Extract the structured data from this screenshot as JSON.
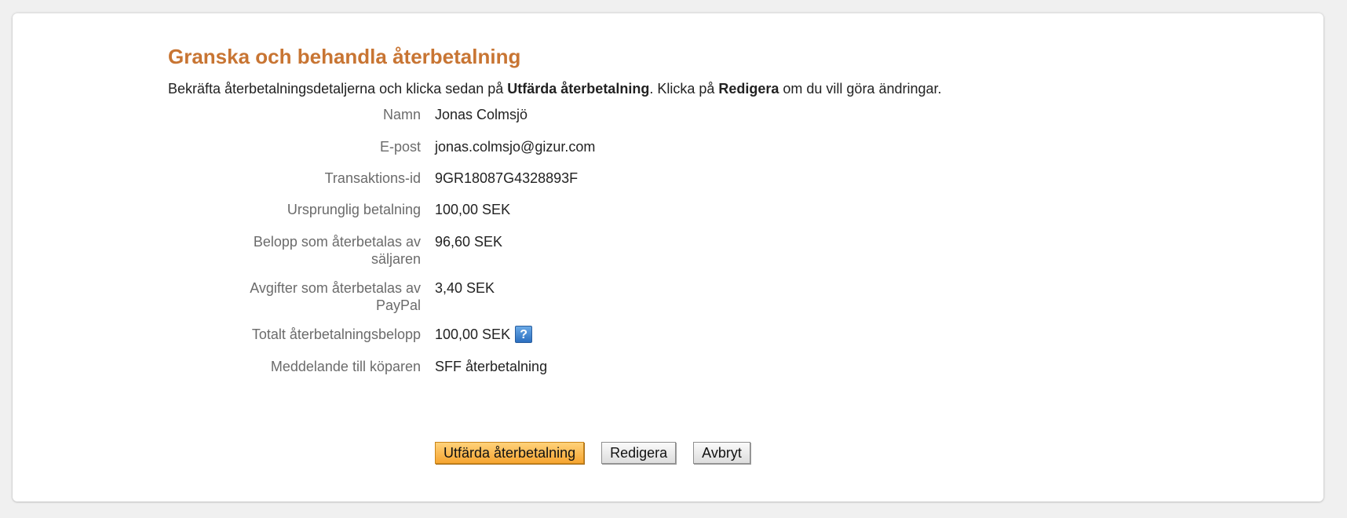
{
  "page": {
    "title": "Granska och behandla återbetalning",
    "instructions": {
      "part1": "Bekräfta återbetalningsdetaljerna och klicka sedan på ",
      "bold1": "Utfärda återbetalning",
      "part2": ". Klicka på ",
      "bold2": "Redigera",
      "part3": " om du vill göra ändringar."
    }
  },
  "details": [
    {
      "label": "Namn",
      "value": "Jonas Colmsjö"
    },
    {
      "label": "E-post",
      "value": "jonas.colmsjo@gizur.com"
    },
    {
      "label": "Transaktions-id",
      "value": "9GR18087G4328893F"
    },
    {
      "label": "Ursprunglig betalning",
      "value": "100,00 SEK"
    },
    {
      "label": "Belopp som återbetalas av säljaren",
      "value": "96,60 SEK"
    },
    {
      "label": "Avgifter som återbetalas av PayPal",
      "value": "3,40 SEK"
    },
    {
      "label": "Totalt återbetalningsbelopp",
      "value": "100,00 SEK",
      "help_icon": "question-mark-icon",
      "help_glyph": "?"
    },
    {
      "label": "Meddelande till köparen",
      "value": "SFF återbetalning"
    }
  ],
  "buttons": {
    "issue_refund": "Utfärda återbetalning",
    "edit": "Redigera",
    "cancel": "Avbryt"
  },
  "colors": {
    "title": "#c87533",
    "primary_button": "#f6a531",
    "help_icon": "#2b6fc0"
  }
}
